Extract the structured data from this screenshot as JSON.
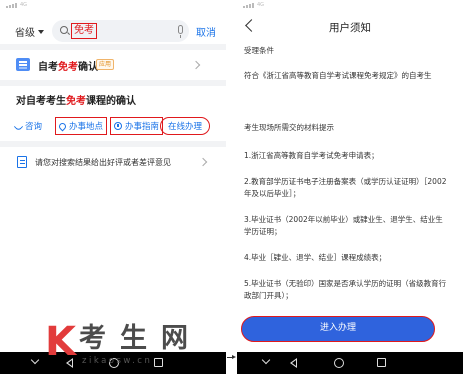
{
  "left_screen": {
    "status_bar": {
      "signal_text": "4G"
    },
    "search": {
      "province_label": "省级",
      "query": "免考",
      "cancel_label": "取消"
    },
    "result_card": {
      "title_prefix": "自考",
      "title_highlight": "免考",
      "title_suffix": "确认",
      "tag": "应用"
    },
    "section": {
      "title_prefix": "对自考考生",
      "title_highlight": "免考",
      "title_suffix": "课程的确认",
      "actions": [
        {
          "label": "咨询",
          "icon": "phone-icon"
        },
        {
          "label": "办事地点",
          "icon": "location-pin-icon"
        },
        {
          "label": "办事指南",
          "icon": "guide-icon"
        },
        {
          "label": "在线办理"
        }
      ]
    },
    "feedback": {
      "text": "请您对搜索结果给出好评或者差评意见",
      "icon": "feedback-icon"
    }
  },
  "right_screen": {
    "status_bar": {
      "signal_text": "4G"
    },
    "header": {
      "title": "用户须知"
    },
    "content": [
      "受理条件",
      "符合《浙江省高等教育自学考试课程免考规定》的自考生",
      "考生现场所需交的材料提示",
      "1.浙江省高等教育自学考试免考申请表；",
      "2.教育部学历证书电子注册备案表（或学历认证证明）［2002年及以后毕业］；",
      "3.毕业证书（2002年以前毕业）或肄业生、退学生、结业生学历证明；",
      "4.毕业［肄业、退学、结业］课程成绩表；",
      "5.毕业证书（无验印）国家是否承认学历的证明（省级教育行政部门开具）；"
    ],
    "agree_button": "进入办理"
  },
  "watermark": {
    "k": "K",
    "chars": "考生网",
    "url": "zikaosw.cn"
  },
  "colors": {
    "accent_blue": "#1a73e8",
    "highlight_red": "#e0191d",
    "button_blue": "#2f63dd"
  }
}
